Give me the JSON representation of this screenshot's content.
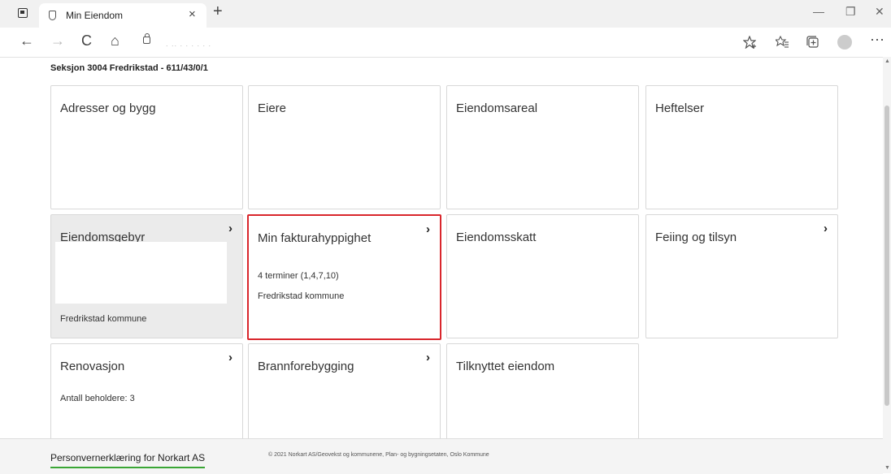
{
  "browser": {
    "tab_title": "Min Eiendom",
    "tab_close": "×",
    "new_tab": "+",
    "win_min": "—",
    "win_restore": "❐",
    "win_close": "✕",
    "back": "←",
    "forward": "→",
    "reload": "C",
    "home": "⌂",
    "address_placeholder": ".  ..        .     .          .   .    .          .",
    "more": "···"
  },
  "page": {
    "heading": "Seksjon 3004 Fredrikstad - 611/43/0/1",
    "cards": [
      {
        "title": "Adresser og bygg"
      },
      {
        "title": "Eiere"
      },
      {
        "title": "Eiendomsareal"
      },
      {
        "title": "Heftelser"
      },
      {
        "title": "Eiendomsgebyr",
        "footer": "Fredrikstad kommune"
      },
      {
        "title": "Min fakturahyppighet",
        "line1": "4 terminer (1,4,7,10)",
        "line2": "Fredrikstad kommune"
      },
      {
        "title": "Eiendomsskatt"
      },
      {
        "title": "Feiing og tilsyn"
      },
      {
        "title": "Renovasjon",
        "line1": "Antall beholdere: 3"
      },
      {
        "title": "Brannforebygging"
      },
      {
        "title": "Tilknyttet eiendom"
      }
    ],
    "chevron": "›"
  },
  "footer": {
    "privacy": "Personvernerklæring for Norkart AS",
    "copyright": "© 2021 Norkart AS/Geovekst og kommunene, Plan- og bygningsetaten, Oslo Kommune"
  },
  "colors": {
    "highlight": "#d9262c",
    "link_underline": "#3aa635",
    "grey_card": "#ebebeb"
  }
}
